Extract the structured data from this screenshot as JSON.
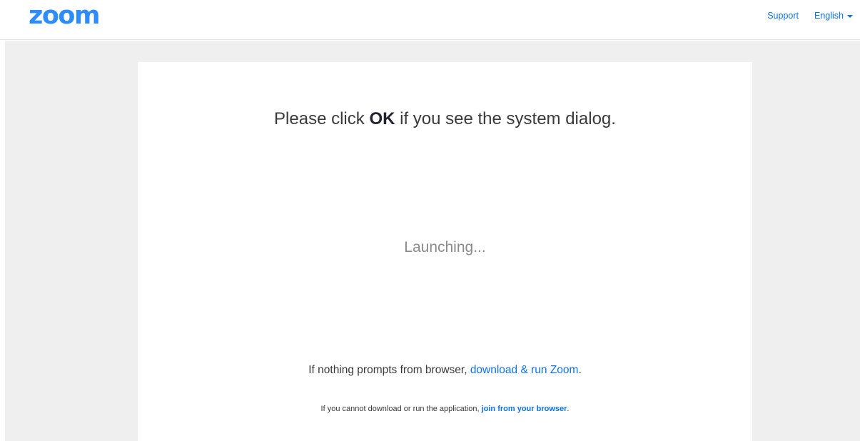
{
  "header": {
    "logo_text": "zoom",
    "support_label": "Support",
    "language_label": "English",
    "language_icon": "caret-down-icon"
  },
  "main": {
    "title_prefix": "Please click ",
    "title_bold": "OK",
    "title_suffix": " if you see the system dialog.",
    "status": "Launching...",
    "prompt_prefix": "If nothing prompts from browser, ",
    "prompt_link": "download & run Zoom",
    "prompt_suffix": ".",
    "fallback_prefix": "If you cannot download or run the application, ",
    "fallback_link": "join from your browser",
    "fallback_suffix": "."
  },
  "colors": {
    "brand": "#2d8cff",
    "link": "#0e71eb",
    "background": "#efefef",
    "text": "#3a3a3a"
  }
}
